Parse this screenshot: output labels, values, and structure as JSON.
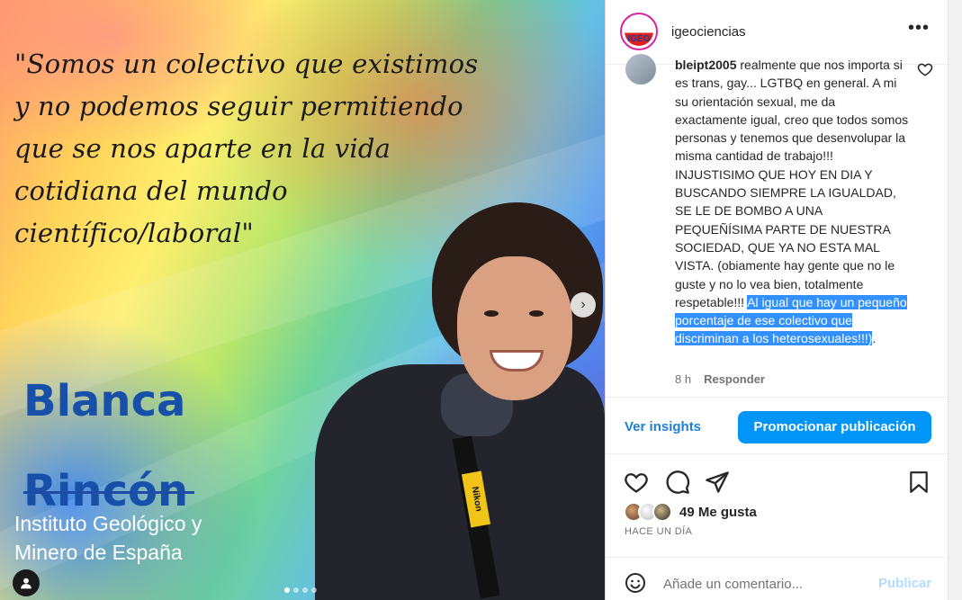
{
  "post_image": {
    "quote": "\"Somos un colectivo que existimos y no podemos seguir permitiendo que se nos aparte en la vida cotidiana del mundo científico/laboral\"",
    "name_line1": "Blanca",
    "name_line2": "Rincón",
    "institution_line1": "Instituto Geológico y",
    "institution_line2": "Minero de España",
    "camera_strap_text": "Nikon",
    "next_icon": "chevron-right-icon",
    "carousel_dots": 4,
    "active_dot": 0
  },
  "header": {
    "avatar_text": "IGEO",
    "username": "igeociencias",
    "more_icon": "more-horizontal-icon"
  },
  "comment": {
    "handle": "bleipt2005",
    "text_plain": " realmente que nos importa si es trans, gay... LGTBQ en general. A mi su orientación sexual, me da exactamente igual, creo que todos somos personas y tenemos que desenvolupar la misma cantidad de trabajo!!! INJUSTISIMO QUE HOY EN DIA Y BUSCANDO SIEMPRE LA IGUALDAD, SE LE DE BOMBO A UNA PEQUEÑÍSIMA PARTE DE NUESTRA SOCIEDAD, QUE YA NO ESTA MAL VISTA. (obiamente hay gente que no le guste y no lo vea bien, totalmente respetable!!! ",
    "text_selected": "Al igual que hay un pequeño porcentaje de ese colectivo que discriminan a los heterosexuales!!!)",
    "text_after": ".",
    "time": "8 h",
    "reply_label": "Responder"
  },
  "insights": {
    "link_label": "Ver insights",
    "promote_label": "Promocionar publicación"
  },
  "engagement": {
    "likes_label": "49 Me gusta",
    "time_ago": "HACE UN DÍA"
  },
  "comment_box": {
    "placeholder": "Añade un comentario...",
    "publish_label": "Publicar"
  },
  "colors": {
    "accent": "#0095f6",
    "link": "#1f7fd6",
    "selection": "#3390ff",
    "name_blue": "#1750a8"
  }
}
